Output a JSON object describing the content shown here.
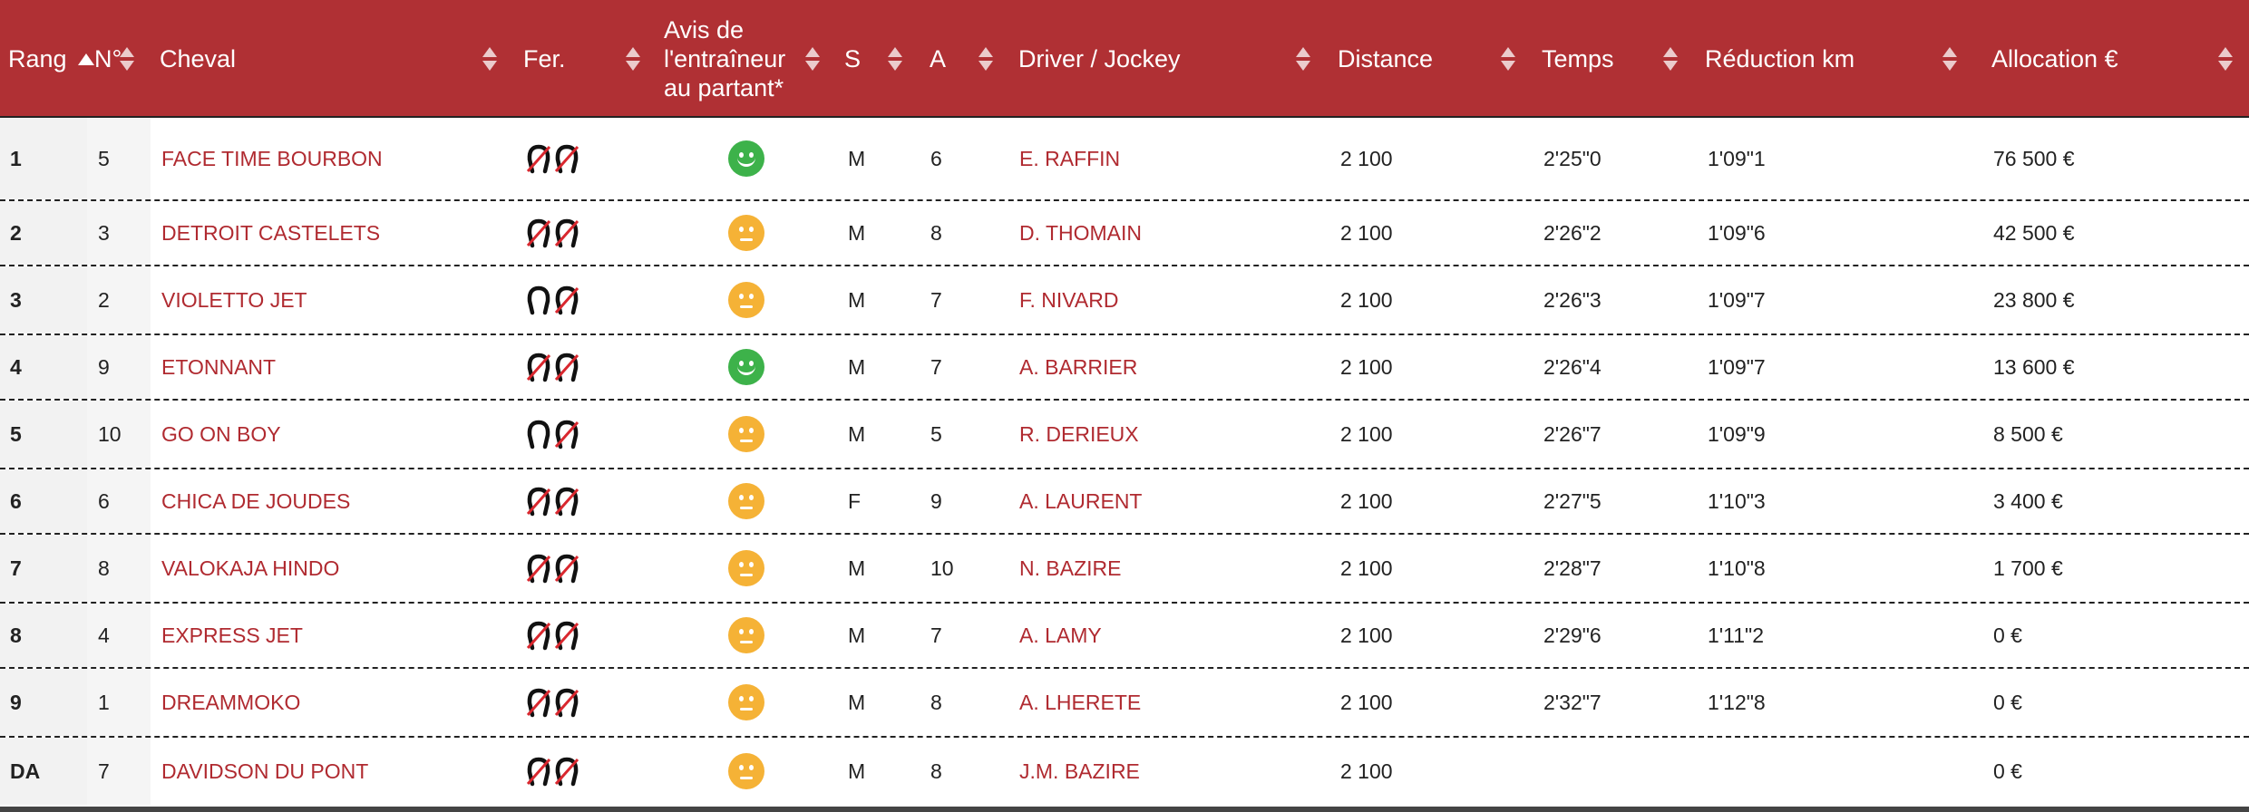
{
  "colors": {
    "header_bg": "#b03034",
    "link": "#b02a30",
    "good": "#3db24a",
    "neutral": "#f5b236"
  },
  "columns": [
    {
      "key": "rang",
      "label": "Rang"
    },
    {
      "key": "num",
      "label": "N°"
    },
    {
      "key": "cheval",
      "label": "Cheval"
    },
    {
      "key": "fer",
      "label": "Fer."
    },
    {
      "key": "avis",
      "label": "Avis de l'entraîneur au partant*"
    },
    {
      "key": "sexe",
      "label": "S"
    },
    {
      "key": "age",
      "label": "A"
    },
    {
      "key": "driver",
      "label": "Driver / Jockey"
    },
    {
      "key": "distance",
      "label": "Distance"
    },
    {
      "key": "temps",
      "label": "Temps"
    },
    {
      "key": "reduction",
      "label": "Réduction km"
    },
    {
      "key": "allocation",
      "label": "Allocation €"
    }
  ],
  "rows": [
    {
      "rang": "1",
      "num": "5",
      "cheval": "FACE TIME BOURBON",
      "fer": [
        "shoe-crossed-icon",
        "shoe-crossed-icon"
      ],
      "avis": "positive-smiley-icon",
      "sexe": "M",
      "age": "6",
      "driver": "E. RAFFIN",
      "distance": "2 100",
      "temps": "2'25\"0",
      "reduction": "1'09\"1",
      "allocation": "76 500 €"
    },
    {
      "rang": "2",
      "num": "3",
      "cheval": "DETROIT CASTELETS",
      "fer": [
        "shoe-crossed-icon",
        "shoe-crossed-icon"
      ],
      "avis": "neutral-smiley-icon",
      "sexe": "M",
      "age": "8",
      "driver": "D. THOMAIN",
      "distance": "2 100",
      "temps": "2'26\"2",
      "reduction": "1'09\"6",
      "allocation": "42 500 €"
    },
    {
      "rang": "3",
      "num": "2",
      "cheval": "VIOLETTO JET",
      "fer": [
        "shoe-icon",
        "shoe-crossed-icon"
      ],
      "avis": "neutral-smiley-icon",
      "sexe": "M",
      "age": "7",
      "driver": "F. NIVARD",
      "distance": "2 100",
      "temps": "2'26\"3",
      "reduction": "1'09\"7",
      "allocation": "23 800 €"
    },
    {
      "rang": "4",
      "num": "9",
      "cheval": "ETONNANT",
      "fer": [
        "shoe-crossed-icon",
        "shoe-crossed-icon"
      ],
      "avis": "positive-smiley-icon",
      "sexe": "M",
      "age": "7",
      "driver": "A. BARRIER",
      "distance": "2 100",
      "temps": "2'26\"4",
      "reduction": "1'09\"7",
      "allocation": "13 600 €"
    },
    {
      "rang": "5",
      "num": "10",
      "cheval": "GO ON BOY",
      "fer": [
        "shoe-icon",
        "shoe-crossed-icon"
      ],
      "avis": "neutral-smiley-icon",
      "sexe": "M",
      "age": "5",
      "driver": "R. DERIEUX",
      "distance": "2 100",
      "temps": "2'26\"7",
      "reduction": "1'09\"9",
      "allocation": "8 500 €"
    },
    {
      "rang": "6",
      "num": "6",
      "cheval": "CHICA DE JOUDES",
      "fer": [
        "shoe-crossed-icon",
        "shoe-crossed-icon"
      ],
      "avis": "neutral-smiley-icon",
      "sexe": "F",
      "age": "9",
      "driver": "A. LAURENT",
      "distance": "2 100",
      "temps": "2'27\"5",
      "reduction": "1'10\"3",
      "allocation": "3 400 €"
    },
    {
      "rang": "7",
      "num": "8",
      "cheval": "VALOKAJA HINDO",
      "fer": [
        "shoe-crossed-icon",
        "shoe-crossed-icon"
      ],
      "avis": "neutral-smiley-icon",
      "sexe": "M",
      "age": "10",
      "driver": "N. BAZIRE",
      "distance": "2 100",
      "temps": "2'28\"7",
      "reduction": "1'10\"8",
      "allocation": "1 700 €"
    },
    {
      "rang": "8",
      "num": "4",
      "cheval": "EXPRESS JET",
      "fer": [
        "shoe-crossed-icon",
        "shoe-crossed-icon"
      ],
      "avis": "neutral-smiley-icon",
      "sexe": "M",
      "age": "7",
      "driver": "A. LAMY",
      "distance": "2 100",
      "temps": "2'29\"6",
      "reduction": "1'11\"2",
      "allocation": "0 €"
    },
    {
      "rang": "9",
      "num": "1",
      "cheval": "DREAMMOKO",
      "fer": [
        "shoe-crossed-icon",
        "shoe-crossed-icon"
      ],
      "avis": "neutral-smiley-icon",
      "sexe": "M",
      "age": "8",
      "driver": "A. LHERETE",
      "distance": "2 100",
      "temps": "2'32\"7",
      "reduction": "1'12\"8",
      "allocation": "0 €"
    },
    {
      "rang": "DA",
      "num": "7",
      "cheval": "DAVIDSON DU PONT",
      "fer": [
        "shoe-crossed-icon",
        "shoe-crossed-icon"
      ],
      "avis": "neutral-smiley-icon",
      "sexe": "M",
      "age": "8",
      "driver": "J.M. BAZIRE",
      "distance": "2 100",
      "temps": "",
      "reduction": "",
      "allocation": "0 €"
    }
  ]
}
